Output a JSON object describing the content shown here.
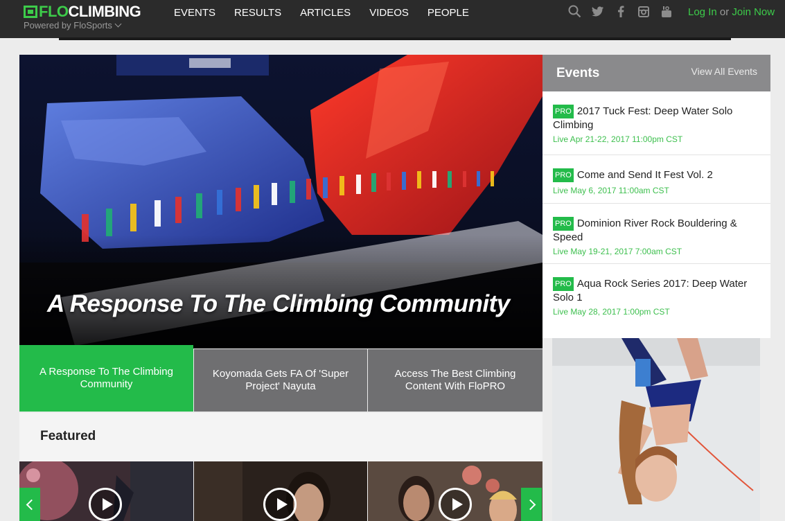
{
  "brand": {
    "flo": "FLO",
    "sport": "CLIMBING",
    "powered_by": "Powered by FloSports"
  },
  "nav": {
    "items": [
      "EVENTS",
      "RESULTS",
      "ARTICLES",
      "VIDEOS",
      "PEOPLE"
    ]
  },
  "social_icons": [
    "search-icon",
    "twitter-icon",
    "facebook-icon",
    "instagram-icon",
    "youtube-icon"
  ],
  "auth": {
    "login": "Log In",
    "or": "or",
    "join": "Join Now"
  },
  "hero": {
    "title": "A Response To The Climbing Community"
  },
  "tabs": [
    {
      "label": "A Response To The Climbing Community",
      "active": true
    },
    {
      "label": "Koyomada Gets FA Of 'Super Project' Nayuta",
      "active": false
    },
    {
      "label": "Access The Best Climbing Content With FloPRO",
      "active": false
    }
  ],
  "featured": {
    "title": "Featured"
  },
  "events": {
    "title": "Events",
    "view_all": "View All Events",
    "items": [
      {
        "badge": "PRO",
        "name": "2017 Tuck Fest: Deep Water Solo Climbing",
        "date": "Live Apr 21-22, 2017 11:00pm CST"
      },
      {
        "badge": "PRO",
        "name": "Come and Send It Fest Vol. 2",
        "date": "Live May 6, 2017 11:00am CST"
      },
      {
        "badge": "PRO",
        "name": "Dominion River Rock Bouldering & Speed",
        "date": "Live May 19-21, 2017 7:00am CST"
      },
      {
        "badge": "PRO",
        "name": "Aqua Rock Series 2017: Deep Water Solo 1",
        "date": "Live May 28, 2017 1:00pm CST"
      }
    ]
  },
  "colors": {
    "brand_green": "#3dcc4a",
    "tab_active": "#23bb4a",
    "tab_inactive": "#6f6f71",
    "nav_bg": "#2b2b2b"
  }
}
